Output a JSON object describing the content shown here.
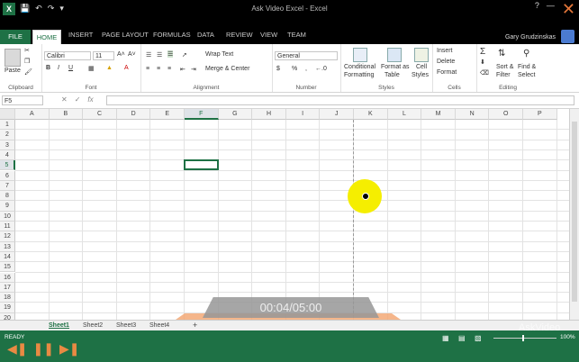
{
  "app": {
    "title": "Ask Video Excel - Excel",
    "user": "Gary Grudzinskas",
    "logo_letter": "X"
  },
  "tabs": [
    "FILE",
    "HOME",
    "INSERT",
    "PAGE LAYOUT",
    "FORMULAS",
    "DATA",
    "REVIEW",
    "VIEW",
    "TEAM"
  ],
  "ribbon": {
    "clipboard": {
      "label": "Clipboard",
      "paste": "Paste"
    },
    "font": {
      "label": "Font",
      "name": "Calibri",
      "size": "11"
    },
    "alignment": {
      "label": "Alignment",
      "wrap": "Wrap Text",
      "merge": "Merge & Center"
    },
    "number": {
      "label": "Number",
      "format": "General",
      "currency": "$",
      "percent": "%",
      "comma": ","
    },
    "styles": {
      "label": "Styles",
      "cond1": "Conditional",
      "cond2": "Formatting",
      "fmt1": "Format as",
      "fmt2": "Table",
      "cell1": "Cell",
      "cell2": "Styles"
    },
    "cells": {
      "label": "Cells",
      "insert": "Insert",
      "delete": "Delete",
      "format": "Format"
    },
    "editing": {
      "label": "Editing",
      "sort1": "Sort &",
      "sort2": "Filter",
      "find1": "Find &",
      "find2": "Select"
    }
  },
  "formula_bar": {
    "name_box": "F5",
    "fx": "fx",
    "cancel": "✕",
    "enter": "✓",
    "value": ""
  },
  "grid": {
    "columns": [
      "A",
      "B",
      "C",
      "D",
      "E",
      "F",
      "G",
      "H",
      "I",
      "J",
      "K",
      "L",
      "M",
      "N",
      "O",
      "P"
    ],
    "rows": [
      "1",
      "2",
      "3",
      "4",
      "5",
      "6",
      "7",
      "8",
      "9",
      "10",
      "11",
      "12",
      "13",
      "14",
      "15",
      "16",
      "17",
      "18",
      "19",
      "20"
    ],
    "active_cell": "F5",
    "active_col": "F",
    "active_row": "5"
  },
  "sheets": {
    "tabs": [
      "Sheet1",
      "Sheet2",
      "Sheet3",
      "Sheet4"
    ],
    "active": "Sheet1",
    "add": "+"
  },
  "status": {
    "ready": "READY",
    "zoom": "100%"
  },
  "video": {
    "time": "00:04/05:00",
    "watermark": "AskVideo"
  },
  "colors": {
    "excel_green": "#1e7145",
    "cursor_highlight": "#f5ee00",
    "overlay_orange": "#f2a46e"
  }
}
